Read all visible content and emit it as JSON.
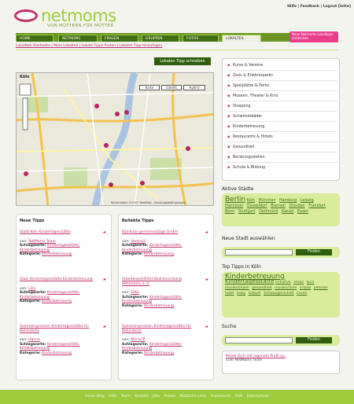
{
  "header": {
    "logo_text": "netmoms",
    "logo_sub": "VON MÜTTERN FÜR MÜTTER",
    "toplinks": "Hilfe | Feedback | Logout [lotte]"
  },
  "nav": {
    "tabs": [
      "HOME",
      "NETMOMS",
      "FRAGEN",
      "GRUPPEN",
      "FOTOS",
      "LOKALTEIL"
    ],
    "promo": "Neue Netmoms Lokaltipps entdecken"
  },
  "breadcrumb": "Lokaltteil Startseite | Mein Lokalteil | Lokale Tipps finden | Lokalen Tipp hinzufügen",
  "map": {
    "button": "Lokalen Tipp schreiben",
    "title": "Köln",
    "view_buttons": [
      "Karte",
      "Satellit",
      "Hybrid"
    ],
    "copyright": "Kartendaten ©2007 TeleAtlas - Nutzungsbedingungen"
  },
  "new_tips": {
    "heading": "Neue Tipps",
    "items": [
      {
        "title": "Stadt Köln Kindertagesstätte",
        "author_label": "von:",
        "author": "NetMoms Team",
        "tags_label": "Schlagworte:",
        "tags": "Kindertagesstätte, Kinderbetreuung",
        "cat_label": "Kategorie:",
        "category": "Kinderbetreuung"
      },
      {
        "title": "Stad. Kindertagesstätte Kinderbetreuung",
        "author_label": "von:",
        "author": "Lilla",
        "tags_label": "Schlagworte:",
        "tags": "Kindertagesstätte, Kinderbetreuung",
        "cat_label": "Kategorie:",
        "category": "Kinderbetreuung"
      },
      {
        "title": "Sommersprossen Kindertagesstätte für Behinderte",
        "author_label": "von:",
        "author": "Hanna",
        "tags_label": "Schlagworte:",
        "tags": "Kindertagesstätte, Kinderbetreuung",
        "cat_label": "Kategorie:",
        "category": "Kinderbetreuung"
      }
    ]
  },
  "popular_tips": {
    "heading": "Beliebte Tipps",
    "items": [
      {
        "title": "Kölnkitas gemeinnützige GmbH",
        "author_label": "von:",
        "author": "Verena3",
        "tags_label": "Schlagworte:",
        "tags": "Kindertagesstätte, Kinderbetreuung",
        "cat_label": "Kategorie:",
        "category": "Kinderbetreuung"
      },
      {
        "title": "Arbeiterwohlfahrt Bezirksverband Mittelrhein e. V.",
        "author_label": "von:",
        "author": "Silke",
        "tags_label": "Schlagworte:",
        "tags": "Kindertagesstätte, Kinderbetreuung",
        "cat_label": "Kategorie:",
        "category": "Kinderbetreuung"
      },
      {
        "title": "Sommersprossen Kindertagesstätte für Behinderte",
        "author_label": "von:",
        "author": "Maria78",
        "tags_label": "Schlagworte:",
        "tags": "Kindertagesstätte, Kinderbetreuung",
        "cat_label": "Kategorie:",
        "category": "Kinderbetreuung"
      }
    ]
  },
  "categories": [
    "Kurse & Vereine",
    "Zoos & Erlebnisparks",
    "Spielplätze & Parks",
    "Museen, Theater & Kino",
    "Shopping",
    "Schwimmbäder",
    "Kinderbetreuung",
    "Restaurants & Hotels",
    "Gesundheit",
    "Beratungsstellen",
    "Schule & Bildung"
  ],
  "cities": {
    "heading": "Aktive Städte",
    "big": "Berlin",
    "list": [
      "Köln",
      "München",
      "Hamburg",
      "Leipzig",
      "Hannover",
      "Düsseldorf",
      "Bremen",
      "Dresden",
      "Frankfurt",
      "Bonn",
      "Stuttgart",
      "Dortmund",
      "Kassel",
      "Essen"
    ]
  },
  "new_city": {
    "heading": "Neue Stadt auswählen",
    "button": "Finden"
  },
  "top_tips": {
    "heading": "Top Tipps in Köln",
    "big": "Kinderbetreuung",
    "mid": "Kindertagesstätte",
    "small": [
      "initiative",
      "veren",
      "kurs",
      "musikschulen",
      "gesundheit",
      "musikschule",
      "urlaub",
      "pension",
      "hotel",
      "baby",
      "Geburt",
      "Schwangerschaft",
      "Essen"
    ]
  },
  "search": {
    "heading": "Suche",
    "button": "Finden"
  },
  "login": {
    "link": "Melde Dich mit eigenem Profil an.",
    "text": "Euer NetMoms Team"
  },
  "footer": {
    "links": [
      "Unser Blog",
      "Hilfe",
      "Team",
      "Kontakt",
      "Jobs",
      "Presse",
      "Nützliche Links",
      "Impressum",
      "AGB",
      "Datenschutz"
    ]
  }
}
